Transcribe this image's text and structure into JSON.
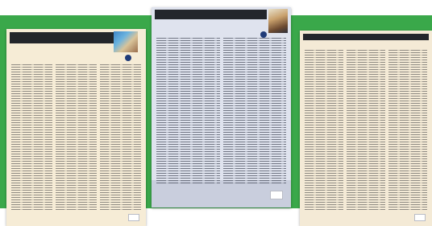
{
  "background": {
    "band_color": "#3aa84a",
    "page_color": "#ffffff"
  },
  "documents": [
    {
      "id": "left",
      "paper_color": "#f6ecd6",
      "header_text": "",
      "title_text": "",
      "footer_text": ""
    },
    {
      "id": "middle",
      "paper_color": "#dfe3ee",
      "header_text": "",
      "title_text": "",
      "footer_text": ""
    },
    {
      "id": "right",
      "paper_color": "#f4ead6",
      "header_text": "",
      "title_text": "",
      "footer_text": ""
    }
  ]
}
